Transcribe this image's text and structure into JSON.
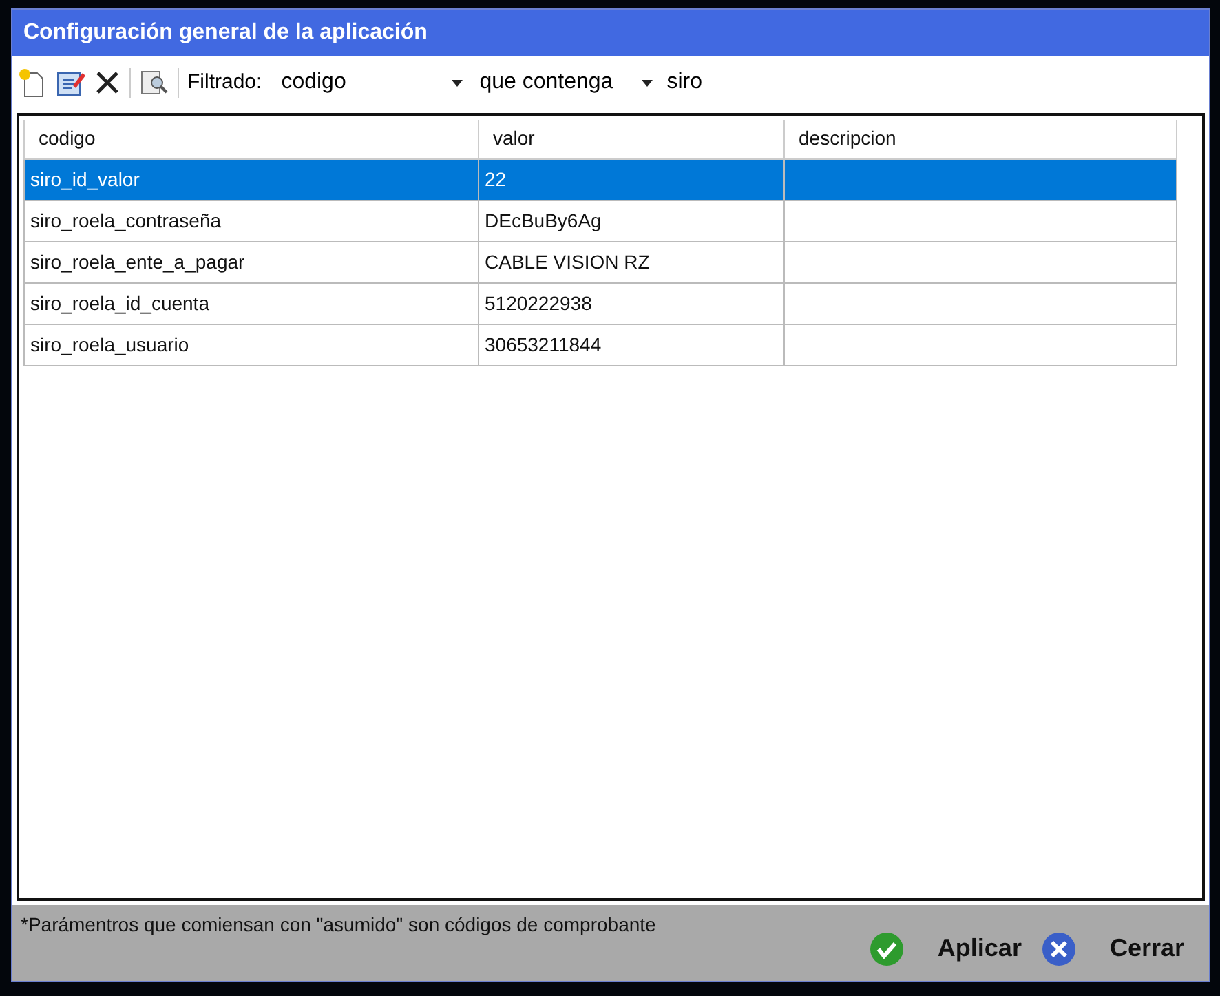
{
  "window": {
    "title": "Configuración general de la aplicación"
  },
  "toolbar": {
    "filter_label": "Filtrado:",
    "field": {
      "value": "codigo"
    },
    "condition": {
      "value": "que contenga"
    },
    "search": {
      "value": "siro"
    }
  },
  "table": {
    "columns": [
      "codigo",
      "valor",
      "descripcion"
    ],
    "rows": [
      {
        "cells": [
          "siro_id_valor",
          "22",
          ""
        ],
        "selected": true
      },
      {
        "cells": [
          "siro_roela_contraseña",
          "DEcBuBy6Ag",
          ""
        ],
        "selected": false
      },
      {
        "cells": [
          "siro_roela_ente_a_pagar",
          "CABLE VISION RZ",
          ""
        ],
        "selected": false
      },
      {
        "cells": [
          "siro_roela_id_cuenta",
          "5120222938",
          ""
        ],
        "selected": false
      },
      {
        "cells": [
          "siro_roela_usuario",
          "30653211844",
          ""
        ],
        "selected": false
      }
    ]
  },
  "footer": {
    "note": "*Parámentros que comiensan con \"asumido\" son códigos de comprobante",
    "buttons": [
      {
        "kind": "apply",
        "label": "Aplicar"
      },
      {
        "kind": "close",
        "label": "Cerrar"
      }
    ]
  }
}
